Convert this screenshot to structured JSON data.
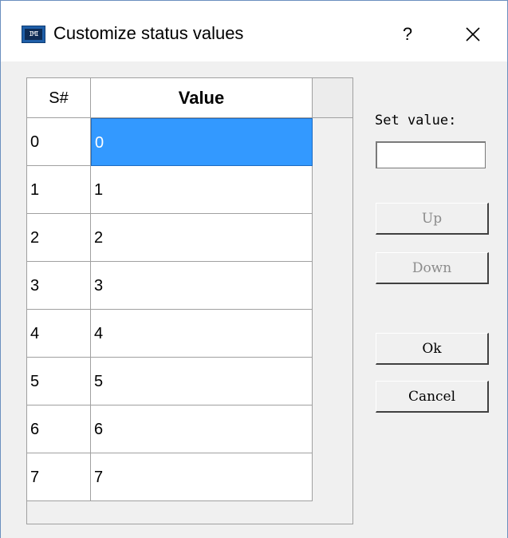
{
  "window": {
    "title": "Customize status values",
    "help_label": "?",
    "app_icon_glyph": "IMI"
  },
  "grid": {
    "columns": [
      "S#",
      "Value"
    ],
    "rows": [
      {
        "sn": "0",
        "value": "0",
        "selected": true
      },
      {
        "sn": "1",
        "value": "1"
      },
      {
        "sn": "2",
        "value": "2"
      },
      {
        "sn": "3",
        "value": "3"
      },
      {
        "sn": "4",
        "value": "4"
      },
      {
        "sn": "5",
        "value": "5"
      },
      {
        "sn": "6",
        "value": "6"
      },
      {
        "sn": "7",
        "value": "7"
      }
    ]
  },
  "panel": {
    "set_value_label": "Set value:",
    "set_value_input": "",
    "up_label": "Up",
    "down_label": "Down",
    "ok_label": "Ok",
    "cancel_label": "Cancel"
  },
  "colors": {
    "selection": "#3399ff",
    "window_border": "#6b8fbf",
    "disabled_text": "#8c8c8c"
  }
}
